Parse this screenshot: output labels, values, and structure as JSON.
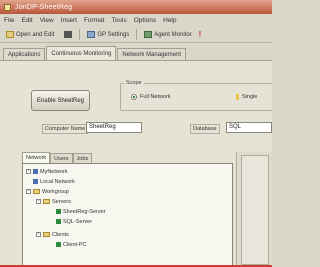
{
  "window": {
    "title": "JonDP-SheetReg"
  },
  "menu": [
    "File",
    "Edit",
    "View",
    "Insert",
    "Format",
    "Tools",
    "Options",
    "Help"
  ],
  "toolbar": {
    "items": [
      {
        "label": "Open and Edit",
        "icon": "folder-icon"
      },
      {
        "label": "",
        "icon": "printer-icon"
      },
      {
        "label": "GP Settings",
        "icon": "settings-icon"
      },
      {
        "label": "Agent Monitor",
        "icon": "monitor-icon"
      }
    ],
    "stop_label": "!"
  },
  "tabs": [
    "Applications",
    "Continuous Monitoring",
    "Network Management"
  ],
  "active_tab": 1,
  "panel": {
    "enable_button": "Enable SheetReg",
    "radio_group_label": "Scope",
    "radio_options": [
      "Full Network",
      "Single"
    ],
    "radio_selected": 0,
    "computer_name_label": "Computer Name",
    "computer_name_value": "SheetReg",
    "database_label": "Database",
    "database_value": "SQL"
  },
  "tree": {
    "tabs": [
      "Network",
      "Users",
      "Jobs"
    ],
    "active_tab": 0,
    "rows": [
      {
        "label": "MyNetwork",
        "indent": 0,
        "icon": "network-icon",
        "expander": "-"
      },
      {
        "label": "Local Network",
        "indent": 0,
        "icon": "computer-icon",
        "expander": ""
      },
      {
        "label": "Workgroup",
        "indent": 0,
        "icon": "workgroup-icon",
        "expander": "-"
      },
      {
        "label": "Servers",
        "indent": 1,
        "icon": "folder-icon",
        "expander": "-"
      },
      {
        "label": "SheetReg-Server",
        "indent": 2,
        "icon": "server-icon",
        "expander": ""
      },
      {
        "label": "SQL-Server",
        "indent": 2,
        "icon": "server-icon",
        "expander": ""
      },
      {
        "label": "Clients",
        "indent": 1,
        "icon": "folder-icon",
        "expander": "-"
      },
      {
        "label": "Client-PC",
        "indent": 2,
        "icon": "client-icon",
        "expander": ""
      }
    ]
  },
  "colors": {
    "titlebar": "#b8563a",
    "tree_icon_green": "#2d8a3a",
    "accent_red": "#c84034"
  }
}
